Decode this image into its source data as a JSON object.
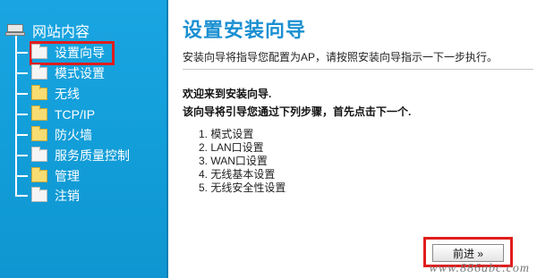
{
  "sidebar": {
    "root_label": "网站内容",
    "items": [
      {
        "label": "设置向导",
        "icon": "page-icon"
      },
      {
        "label": "模式设置",
        "icon": "page-icon"
      },
      {
        "label": "无线",
        "icon": "folder-icon"
      },
      {
        "label": "TCP/IP",
        "icon": "folder-icon"
      },
      {
        "label": "防火墙",
        "icon": "folder-icon"
      },
      {
        "label": "服务质量控制",
        "icon": "page-icon"
      },
      {
        "label": "管理",
        "icon": "folder-icon"
      },
      {
        "label": "注销",
        "icon": "page-icon"
      }
    ],
    "active_index": 0,
    "highlight_color": "#e01d1d",
    "background_color": "#129ed9"
  },
  "main": {
    "title": "设置安装向导",
    "subtitle": "安装向导将指导您配置为AP，请按照安装向导指示一下一步执行。",
    "welcome": "欢迎来到安装向导.",
    "intro": "该向导将引导您通过下列步骤，首先点击下一个.",
    "steps": [
      "1. 模式设置",
      "2. LAN口设置",
      "3. WAN口设置",
      "4. 无线基本设置",
      "5. 无线安全性设置"
    ],
    "next_button": "前进 »",
    "title_color": "#1a8fd1"
  },
  "watermark": "www.886abc.com"
}
